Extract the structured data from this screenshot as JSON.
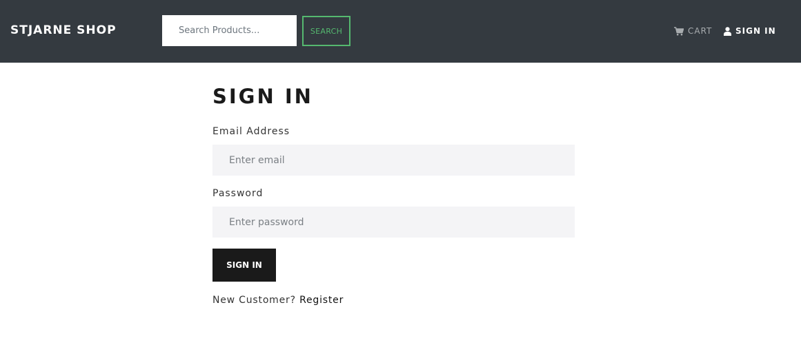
{
  "header": {
    "brand": "STJARNE SHOP",
    "search_placeholder": "Search Products...",
    "search_button": "SEARCH",
    "cart_label": "CART",
    "cart_icon": "shopping-cart-icon",
    "signin_label": "SIGN IN",
    "signin_icon": "user-icon"
  },
  "form": {
    "title": "SIGN IN",
    "email_label": "Email Address",
    "email_placeholder": "Enter email",
    "email_value": "",
    "password_label": "Password",
    "password_placeholder": "Enter password",
    "password_value": "",
    "submit_label": "SIGN IN",
    "new_customer_text": "New Customer? ",
    "register_link": "Register"
  },
  "colors": {
    "navbar_bg": "#343a40",
    "search_accent": "#55b96f",
    "button_bg": "#1a1a1a",
    "input_bg": "#f4f4f6"
  }
}
